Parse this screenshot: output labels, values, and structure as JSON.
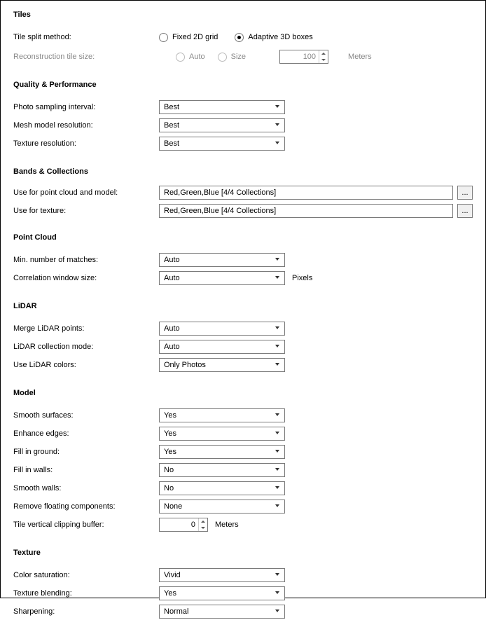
{
  "tiles": {
    "title": "Tiles",
    "split_label": "Tile split method:",
    "fixed2d": "Fixed 2D grid",
    "adaptive3d": "Adaptive 3D boxes",
    "recon_label": "Reconstruction tile size:",
    "auto": "Auto",
    "size": "Size",
    "size_value": "100",
    "meters": "Meters"
  },
  "quality": {
    "title": "Quality & Performance",
    "sampling_label": "Photo sampling interval:",
    "sampling_value": "Best",
    "mesh_label": "Mesh model resolution:",
    "mesh_value": "Best",
    "texture_label": "Texture resolution:",
    "texture_value": "Best"
  },
  "bands": {
    "title": "Bands & Collections",
    "pc_label": "Use for point cloud and model:",
    "pc_value": "Red,Green,Blue [4/4 Collections]",
    "tex_label": "Use for texture:",
    "tex_value": "Red,Green,Blue [4/4 Collections]",
    "browse": "..."
  },
  "pointcloud": {
    "title": "Point Cloud",
    "matches_label": "Min. number of matches:",
    "matches_value": "Auto",
    "corr_label": "Correlation window size:",
    "corr_value": "Auto",
    "pixels": "Pixels"
  },
  "lidar": {
    "title": "LiDAR",
    "merge_label": "Merge LiDAR points:",
    "merge_value": "Auto",
    "mode_label": "LiDAR collection mode:",
    "mode_value": "Auto",
    "colors_label": "Use LiDAR colors:",
    "colors_value": "Only Photos"
  },
  "model": {
    "title": "Model",
    "smooth_label": "Smooth surfaces:",
    "smooth_value": "Yes",
    "edges_label": "Enhance edges:",
    "edges_value": "Yes",
    "ground_label": "Fill in ground:",
    "ground_value": "Yes",
    "walls_label": "Fill in walls:",
    "walls_value": "No",
    "smoothwalls_label": "Smooth walls:",
    "smoothwalls_value": "No",
    "float_label": "Remove floating components:",
    "float_value": "None",
    "clip_label": "Tile vertical clipping buffer:",
    "clip_value": "0",
    "meters": "Meters"
  },
  "texture": {
    "title": "Texture",
    "sat_label": "Color saturation:",
    "sat_value": "Vivid",
    "blend_label": "Texture blending:",
    "blend_value": "Yes",
    "sharp_label": "Sharpening:",
    "sharp_value": "Normal"
  }
}
